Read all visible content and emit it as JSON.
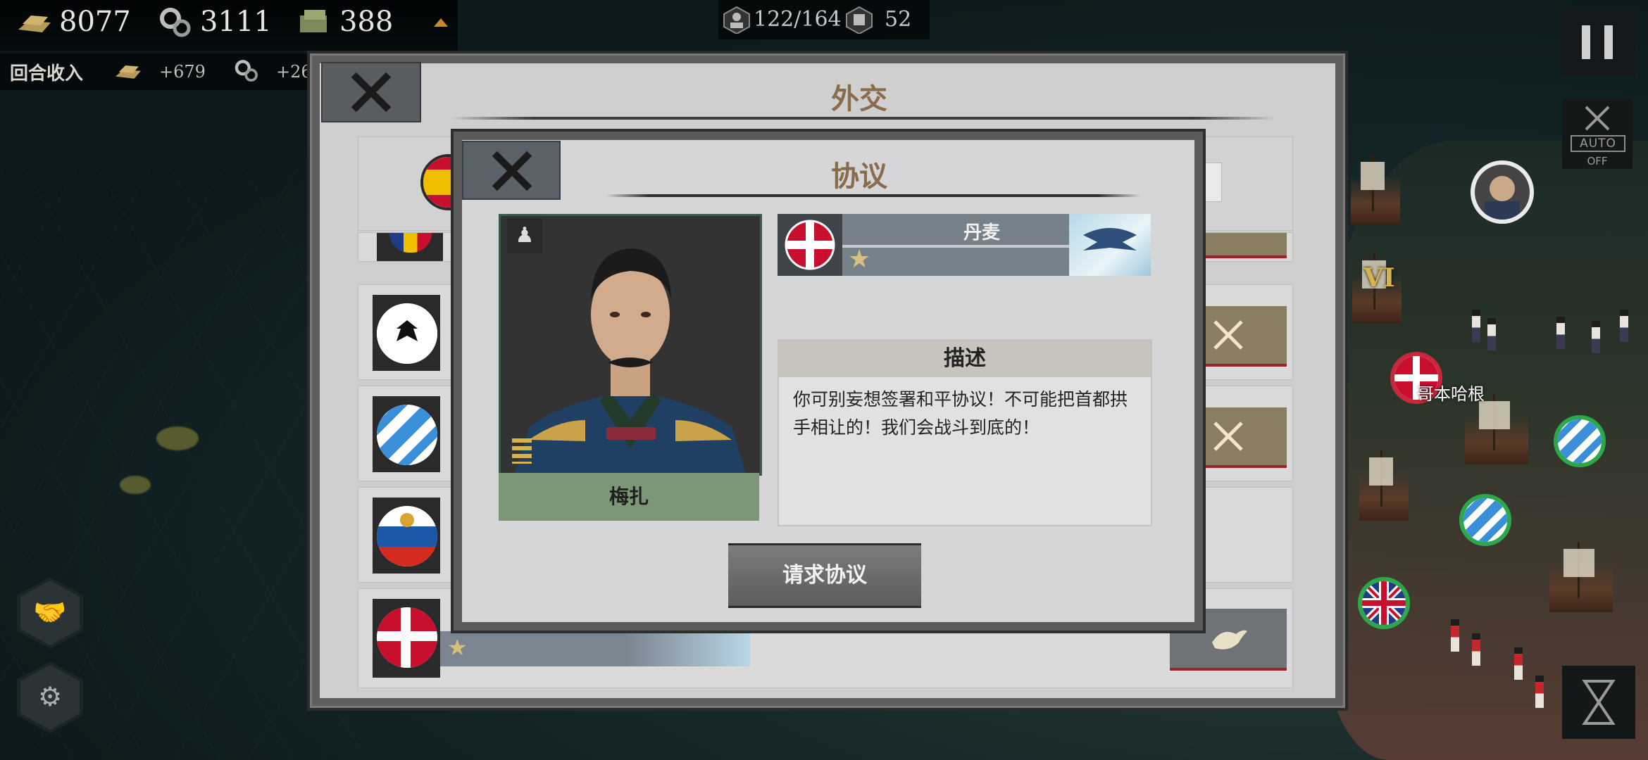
{
  "resources": {
    "gold": "8077",
    "industry": "3111",
    "food": "388"
  },
  "income": {
    "label": "回合收入",
    "gold": "+679",
    "industry": "+26"
  },
  "top_center": {
    "population": "122/164",
    "commanders": "52"
  },
  "auto_button": {
    "label": "AUTO",
    "state": "OFF"
  },
  "map": {
    "city_label": "哥本哈根",
    "unit_badge": "VI"
  },
  "diplomacy_panel": {
    "title": "外交",
    "rows": [
      {
        "flag": "spain-flag"
      },
      {
        "flag": "prussia-flag"
      },
      {
        "flag": "bavaria-flag"
      },
      {
        "flag": "russia-flag"
      },
      {
        "flag": "denmark-flag",
        "stars": "★"
      }
    ]
  },
  "agreement_dialog": {
    "title": "协议",
    "general_name": "梅扎",
    "nation_name": "丹麦",
    "nation_stars": "★",
    "description_header": "描述",
    "description_text": "你可别妄想签署和平协议！不可能把首都拱手相让的！我们会战斗到底的！",
    "request_button": "请求协议"
  },
  "colors": {
    "title_brown": "#8a6b4a",
    "name_bar_green": "#7d9678",
    "denmark_red": "#c8102e"
  }
}
